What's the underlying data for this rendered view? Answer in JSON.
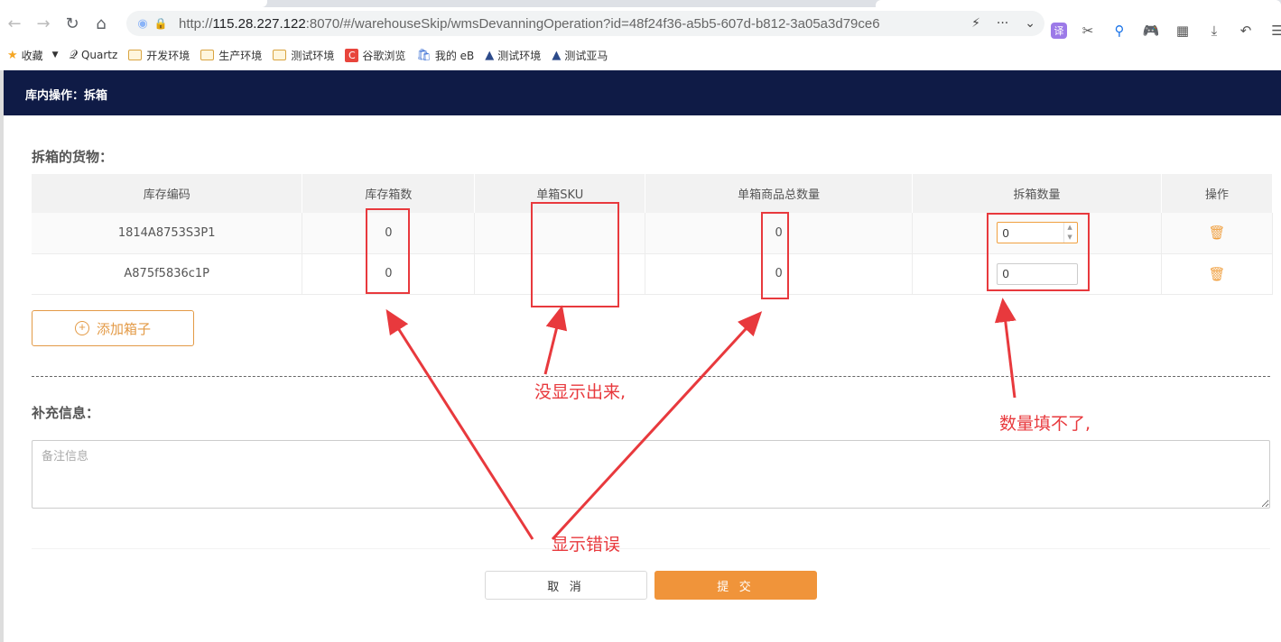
{
  "browser": {
    "url_scheme": "http://",
    "url_host": "115.28.227.122",
    "url_rest": ":8070/#/warehouseSkip/wmsDevanningOperation?id=48f24f36-a5b5-607d-b812-3a05a3d79ce6",
    "icons": [
      "back-icon",
      "forward-icon",
      "reload-icon",
      "home-icon",
      "lightning-icon",
      "more-icon",
      "chevron-down-icon"
    ],
    "extensions": [
      "translate-icon",
      "scissors-icon",
      "search-icon",
      "gamepad-icon",
      "grid-icon",
      "download-icon",
      "undo-icon",
      "menu-icon"
    ],
    "ext_translate_label": "译"
  },
  "bookmarks": [
    {
      "label": "收藏",
      "icon": "star-icon"
    },
    {
      "label": "Quartz",
      "icon": "quartz-icon"
    },
    {
      "label": "开发环境",
      "icon": "folder-icon"
    },
    {
      "label": "生产环境",
      "icon": "folder-icon"
    },
    {
      "label": "测试环境",
      "icon": "folder-icon"
    },
    {
      "label": "谷歌浏览",
      "icon": "c-icon"
    },
    {
      "label": "我的 eB",
      "icon": "bag-icon"
    },
    {
      "label": "测试环境",
      "icon": "triangle-logo-icon"
    },
    {
      "label": "测试亚马",
      "icon": "triangle-logo-icon"
    }
  ],
  "header": {
    "title": "库内操作：拆箱"
  },
  "goods_section": {
    "title": "拆箱的货物："
  },
  "table": {
    "columns": [
      "库存编码",
      "库存箱数",
      "单箱SKU",
      "单箱商品总数量",
      "拆箱数量",
      "操作"
    ],
    "rows": [
      {
        "code": "1814A8753S3P1",
        "boxes": "0",
        "sku": "",
        "total": "0",
        "qty": "0"
      },
      {
        "code": "A875f5836c1P",
        "boxes": "0",
        "sku": "",
        "total": "0",
        "qty": "0"
      }
    ]
  },
  "add_box": {
    "label": "添加箱子"
  },
  "extra_section": {
    "title": "补充信息："
  },
  "remark": {
    "placeholder": "备注信息",
    "value": ""
  },
  "actions": {
    "cancel": "取 消",
    "submit": "提 交"
  },
  "annotations": {
    "not_shown": "没显示出来,",
    "cannot_fill": "数量填不了,",
    "display_error": "显示错误",
    "color": "#e8393d"
  },
  "colors": {
    "header_bg": "#0f1b46",
    "accent": "#f0943a"
  }
}
